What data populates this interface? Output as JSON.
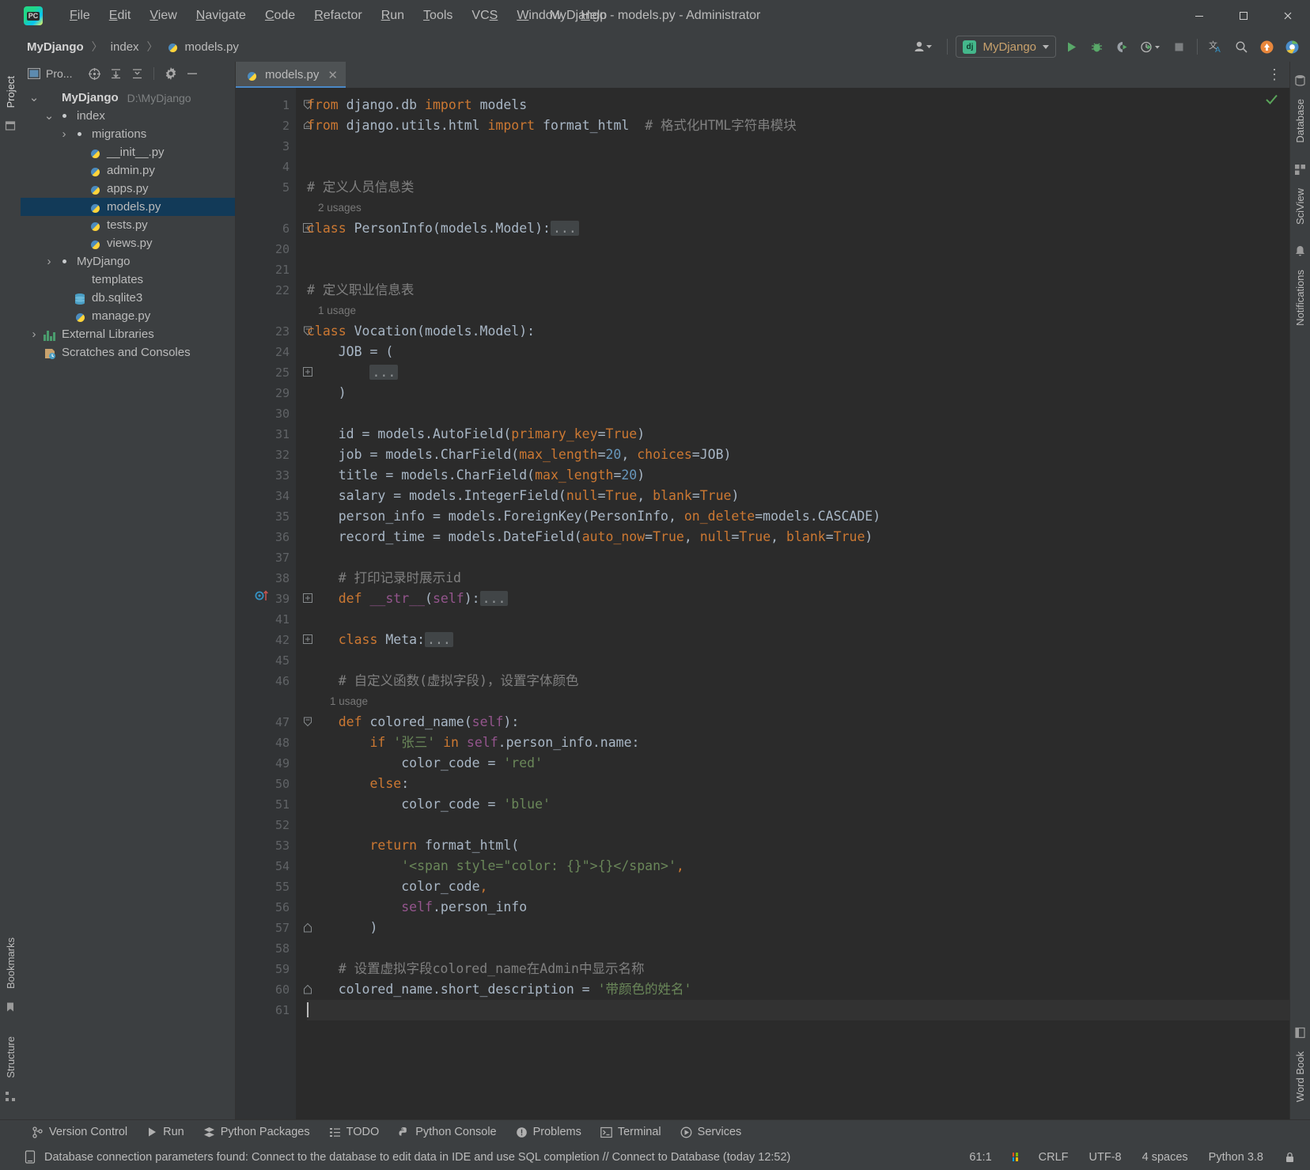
{
  "window": {
    "title": "MyDjango - models.py - Administrator",
    "logo_text": "PC",
    "minimize": "—",
    "maximize": "☐",
    "close": "✕"
  },
  "menu": [
    {
      "label": "File"
    },
    {
      "label": "Edit"
    },
    {
      "label": "View"
    },
    {
      "label": "Navigate"
    },
    {
      "label": "Code"
    },
    {
      "label": "Refactor"
    },
    {
      "label": "Run"
    },
    {
      "label": "Tools"
    },
    {
      "label": "VCS"
    },
    {
      "label": "Window"
    },
    {
      "label": "Help"
    }
  ],
  "breadcrumbs": [
    {
      "label": "MyDjango",
      "bold": true
    },
    {
      "label": "index",
      "bold": false
    },
    {
      "label": "models.py",
      "bold": false
    }
  ],
  "toolbar": {
    "run_config": "MyDjango",
    "django_badge": "dj",
    "run_tooltip": "Run",
    "debug_tooltip": "Debug",
    "coverage_tooltip": "Run with Coverage",
    "profile_tooltip": "Profile",
    "stop_tooltip": "Stop",
    "translate_tooltip": "Translate",
    "search_tooltip": "Search Everywhere",
    "updates_tooltip": "Updates",
    "browser_tooltip": "Open in Browser"
  },
  "project_panel": {
    "header_title": "Pro...",
    "tree": [
      {
        "depth": 0,
        "label": "MyDjango",
        "path": "D:\\MyDjango",
        "icon": "folder",
        "arrow": "down",
        "bold": true,
        "selected": false
      },
      {
        "depth": 1,
        "label": "index",
        "path": "",
        "icon": "folder-source",
        "arrow": "down",
        "bold": false,
        "selected": false
      },
      {
        "depth": 2,
        "label": "migrations",
        "path": "",
        "icon": "folder-source",
        "arrow": "right",
        "bold": false,
        "selected": false
      },
      {
        "depth": 3,
        "label": "__init__.py",
        "path": "",
        "icon": "python",
        "arrow": "none",
        "bold": false,
        "selected": false
      },
      {
        "depth": 3,
        "label": "admin.py",
        "path": "",
        "icon": "python",
        "arrow": "none",
        "bold": false,
        "selected": false
      },
      {
        "depth": 3,
        "label": "apps.py",
        "path": "",
        "icon": "python",
        "arrow": "none",
        "bold": false,
        "selected": false
      },
      {
        "depth": 3,
        "label": "models.py",
        "path": "",
        "icon": "python",
        "arrow": "none",
        "bold": false,
        "selected": true
      },
      {
        "depth": 3,
        "label": "tests.py",
        "path": "",
        "icon": "python",
        "arrow": "none",
        "bold": false,
        "selected": false
      },
      {
        "depth": 3,
        "label": "views.py",
        "path": "",
        "icon": "python",
        "arrow": "none",
        "bold": false,
        "selected": false
      },
      {
        "depth": 1,
        "label": "MyDjango",
        "path": "",
        "icon": "folder-source",
        "arrow": "right",
        "bold": false,
        "selected": false
      },
      {
        "depth": 2,
        "label": "templates",
        "path": "",
        "icon": "folder-template",
        "arrow": "none",
        "bold": false,
        "selected": false
      },
      {
        "depth": 2,
        "label": "db.sqlite3",
        "path": "",
        "icon": "database",
        "arrow": "none",
        "bold": false,
        "selected": false
      },
      {
        "depth": 2,
        "label": "manage.py",
        "path": "",
        "icon": "python",
        "arrow": "none",
        "bold": false,
        "selected": false
      },
      {
        "depth": 0,
        "label": "External Libraries",
        "path": "",
        "icon": "library",
        "arrow": "right",
        "bold": false,
        "selected": false
      },
      {
        "depth": 0,
        "label": "Scratches and Consoles",
        "path": "",
        "icon": "scratch",
        "arrow": "none",
        "bold": false,
        "selected": false
      }
    ]
  },
  "left_strip": {
    "project_tab": "Project",
    "bookmarks_tab": "Bookmarks",
    "structure_tab": "Structure"
  },
  "right_strip": {
    "database_tab": "Database",
    "sciview_tab": "SciView",
    "notifications_tab": "Notifications",
    "wordbook_tab": "Word Book"
  },
  "editor": {
    "tab_label": "models.py",
    "tab_close": "✕",
    "more_actions": "⋮",
    "lines": [
      {
        "num": "1",
        "fold": "down-start",
        "indent": 0,
        "tokens": [
          {
            "t": "from",
            "c": "kw"
          },
          {
            "t": " django.db ",
            "c": ""
          },
          {
            "t": "import",
            "c": "kw"
          },
          {
            "t": " models",
            "c": ""
          }
        ]
      },
      {
        "num": "2",
        "fold": "end",
        "indent": 0,
        "tokens": [
          {
            "t": "from",
            "c": "kw"
          },
          {
            "t": " django.utils.html ",
            "c": ""
          },
          {
            "t": "import",
            "c": "kw"
          },
          {
            "t": " format_html  ",
            "c": ""
          },
          {
            "t": "# 格式化HTML字符串模块",
            "c": "com"
          }
        ]
      },
      {
        "num": "3",
        "fold": "",
        "indent": 0,
        "tokens": []
      },
      {
        "num": "4",
        "fold": "",
        "indent": 0,
        "tokens": []
      },
      {
        "num": "5",
        "fold": "",
        "indent": 0,
        "tokens": [
          {
            "t": "# 定义人员信息类",
            "c": "com"
          }
        ]
      },
      {
        "num": "",
        "fold": "",
        "indent": 0,
        "usage": "2 usages"
      },
      {
        "num": "6",
        "fold": "plus",
        "indent": 0,
        "tokens": [
          {
            "t": "class",
            "c": "kw"
          },
          {
            "t": " PersonInfo(models.Model):",
            "c": ""
          },
          {
            "t": "...",
            "c": "dots"
          }
        ]
      },
      {
        "num": "20",
        "fold": "",
        "indent": 0,
        "tokens": []
      },
      {
        "num": "21",
        "fold": "",
        "indent": 0,
        "tokens": []
      },
      {
        "num": "22",
        "fold": "",
        "indent": 0,
        "tokens": [
          {
            "t": "# 定义职业信息表",
            "c": "com"
          }
        ]
      },
      {
        "num": "",
        "fold": "",
        "indent": 0,
        "usage": "1 usage"
      },
      {
        "num": "23",
        "fold": "down-start",
        "indent": 0,
        "tokens": [
          {
            "t": "class",
            "c": "kw"
          },
          {
            "t": " Vocation(models.Model):",
            "c": ""
          }
        ]
      },
      {
        "num": "24",
        "fold": "",
        "indent": 1,
        "tokens": [
          {
            "t": "    JOB = (",
            "c": ""
          }
        ]
      },
      {
        "num": "25",
        "fold": "plus",
        "indent": 2,
        "tokens": [
          {
            "t": "        ",
            "c": ""
          },
          {
            "t": "...",
            "c": "dots"
          }
        ]
      },
      {
        "num": "29",
        "fold": "",
        "indent": 1,
        "tokens": [
          {
            "t": "    )",
            "c": ""
          }
        ]
      },
      {
        "num": "30",
        "fold": "",
        "indent": 0,
        "tokens": []
      },
      {
        "num": "31",
        "fold": "",
        "indent": 1,
        "tokens": [
          {
            "t": "    id = models.AutoField(",
            "c": ""
          },
          {
            "t": "primary_key",
            "c": "param"
          },
          {
            "t": "=",
            "c": ""
          },
          {
            "t": "True",
            "c": "kw"
          },
          {
            "t": ")",
            "c": ""
          }
        ]
      },
      {
        "num": "32",
        "fold": "",
        "indent": 1,
        "tokens": [
          {
            "t": "    job = models.CharField(",
            "c": ""
          },
          {
            "t": "max_length",
            "c": "param"
          },
          {
            "t": "=",
            "c": ""
          },
          {
            "t": "20",
            "c": "num"
          },
          {
            "t": ", ",
            "c": ""
          },
          {
            "t": "choices",
            "c": "param"
          },
          {
            "t": "=JOB)",
            "c": ""
          }
        ]
      },
      {
        "num": "33",
        "fold": "",
        "indent": 1,
        "tokens": [
          {
            "t": "    title = models.CharField(",
            "c": ""
          },
          {
            "t": "max_length",
            "c": "param"
          },
          {
            "t": "=",
            "c": ""
          },
          {
            "t": "20",
            "c": "num"
          },
          {
            "t": ")",
            "c": ""
          }
        ]
      },
      {
        "num": "34",
        "fold": "",
        "indent": 1,
        "tokens": [
          {
            "t": "    salary = models.IntegerField(",
            "c": ""
          },
          {
            "t": "null",
            "c": "param"
          },
          {
            "t": "=",
            "c": ""
          },
          {
            "t": "True",
            "c": "kw"
          },
          {
            "t": ", ",
            "c": ""
          },
          {
            "t": "blank",
            "c": "param"
          },
          {
            "t": "=",
            "c": ""
          },
          {
            "t": "True",
            "c": "kw"
          },
          {
            "t": ")",
            "c": ""
          }
        ]
      },
      {
        "num": "35",
        "fold": "",
        "indent": 1,
        "tokens": [
          {
            "t": "    person_info = models.ForeignKey(PersonInfo, ",
            "c": ""
          },
          {
            "t": "on_delete",
            "c": "param"
          },
          {
            "t": "=models.CASCADE)",
            "c": ""
          }
        ]
      },
      {
        "num": "36",
        "fold": "",
        "indent": 1,
        "tokens": [
          {
            "t": "    record_time = models.DateField(",
            "c": ""
          },
          {
            "t": "auto_now",
            "c": "param"
          },
          {
            "t": "=",
            "c": ""
          },
          {
            "t": "True",
            "c": "kw"
          },
          {
            "t": ", ",
            "c": ""
          },
          {
            "t": "null",
            "c": "param"
          },
          {
            "t": "=",
            "c": ""
          },
          {
            "t": "True",
            "c": "kw"
          },
          {
            "t": ", ",
            "c": ""
          },
          {
            "t": "blank",
            "c": "param"
          },
          {
            "t": "=",
            "c": ""
          },
          {
            "t": "True",
            "c": "kw"
          },
          {
            "t": ")",
            "c": ""
          }
        ]
      },
      {
        "num": "37",
        "fold": "",
        "indent": 0,
        "tokens": []
      },
      {
        "num": "38",
        "fold": "",
        "indent": 1,
        "tokens": [
          {
            "t": "    # 打印记录时展示id",
            "c": "com"
          }
        ]
      },
      {
        "num": "39",
        "fold": "plus",
        "gmark": "override",
        "indent": 1,
        "tokens": [
          {
            "t": "    ",
            "c": ""
          },
          {
            "t": "def",
            "c": "kw"
          },
          {
            "t": " ",
            "c": ""
          },
          {
            "t": "__str__",
            "c": "self"
          },
          {
            "t": "(",
            "c": ""
          },
          {
            "t": "self",
            "c": "self"
          },
          {
            "t": "):",
            "c": ""
          },
          {
            "t": "...",
            "c": "dots"
          }
        ]
      },
      {
        "num": "41",
        "fold": "",
        "indent": 0,
        "tokens": []
      },
      {
        "num": "42",
        "fold": "plus",
        "indent": 1,
        "tokens": [
          {
            "t": "    ",
            "c": ""
          },
          {
            "t": "class",
            "c": "kw"
          },
          {
            "t": " Meta:",
            "c": ""
          },
          {
            "t": "...",
            "c": "dots"
          }
        ]
      },
      {
        "num": "45",
        "fold": "",
        "indent": 0,
        "tokens": []
      },
      {
        "num": "46",
        "fold": "",
        "indent": 1,
        "tokens": [
          {
            "t": "    # 自定义函数(虚拟字段)，设置字体颜色",
            "c": "com"
          }
        ]
      },
      {
        "num": "",
        "fold": "",
        "indent": 1,
        "usage": "    1 usage"
      },
      {
        "num": "47",
        "fold": "down-start",
        "indent": 1,
        "tokens": [
          {
            "t": "    ",
            "c": ""
          },
          {
            "t": "def",
            "c": "kw"
          },
          {
            "t": " ",
            "c": ""
          },
          {
            "t": "colored_name",
            "c": ""
          },
          {
            "t": "(",
            "c": ""
          },
          {
            "t": "self",
            "c": "self"
          },
          {
            "t": "):",
            "c": ""
          }
        ]
      },
      {
        "num": "48",
        "fold": "",
        "indent": 2,
        "tokens": [
          {
            "t": "        ",
            "c": ""
          },
          {
            "t": "if",
            "c": "kw"
          },
          {
            "t": " ",
            "c": ""
          },
          {
            "t": "'张三'",
            "c": "str"
          },
          {
            "t": " ",
            "c": ""
          },
          {
            "t": "in",
            "c": "kw"
          },
          {
            "t": " ",
            "c": ""
          },
          {
            "t": "self",
            "c": "self"
          },
          {
            "t": ".person_info.name:",
            "c": ""
          }
        ]
      },
      {
        "num": "49",
        "fold": "",
        "indent": 3,
        "tokens": [
          {
            "t": "            color_code = ",
            "c": ""
          },
          {
            "t": "'red'",
            "c": "str"
          }
        ]
      },
      {
        "num": "50",
        "fold": "",
        "indent": 2,
        "tokens": [
          {
            "t": "        ",
            "c": ""
          },
          {
            "t": "else",
            "c": "kw"
          },
          {
            "t": ":",
            "c": ""
          }
        ]
      },
      {
        "num": "51",
        "fold": "",
        "indent": 3,
        "tokens": [
          {
            "t": "            color_code = ",
            "c": ""
          },
          {
            "t": "'blue'",
            "c": "str"
          }
        ]
      },
      {
        "num": "52",
        "fold": "",
        "indent": 2,
        "tokens": []
      },
      {
        "num": "53",
        "fold": "",
        "indent": 2,
        "tokens": [
          {
            "t": "        ",
            "c": ""
          },
          {
            "t": "return",
            "c": "kw"
          },
          {
            "t": " format_html(",
            "c": ""
          }
        ]
      },
      {
        "num": "54",
        "fold": "",
        "indent": 3,
        "tokens": [
          {
            "t": "            ",
            "c": ""
          },
          {
            "t": "'<span style=\"color: {}\">{}</span>'",
            "c": "str"
          },
          {
            "t": ",",
            "c": "kw"
          }
        ]
      },
      {
        "num": "55",
        "fold": "",
        "indent": 3,
        "tokens": [
          {
            "t": "            color_code",
            "c": ""
          },
          {
            "t": ",",
            "c": "kw"
          }
        ]
      },
      {
        "num": "56",
        "fold": "",
        "indent": 3,
        "tokens": [
          {
            "t": "            ",
            "c": ""
          },
          {
            "t": "self",
            "c": "self"
          },
          {
            "t": ".person_info",
            "c": ""
          }
        ]
      },
      {
        "num": "57",
        "fold": "up-end",
        "indent": 2,
        "tokens": [
          {
            "t": "        )",
            "c": ""
          }
        ]
      },
      {
        "num": "58",
        "fold": "",
        "indent": 0,
        "tokens": []
      },
      {
        "num": "59",
        "fold": "",
        "indent": 1,
        "tokens": [
          {
            "t": "    # 设置虚拟字段colored_name在Admin中显示名称",
            "c": "com"
          }
        ]
      },
      {
        "num": "60",
        "fold": "up-end",
        "indent": 1,
        "tokens": [
          {
            "t": "    colored_name.short_description = ",
            "c": ""
          },
          {
            "t": "'带颜色的姓名'",
            "c": "str"
          }
        ]
      },
      {
        "num": "61",
        "fold": "",
        "indent": 1,
        "current": true,
        "caret": true,
        "tokens": []
      }
    ]
  },
  "bottom_bar": [
    {
      "label": "Version Control",
      "icon": "branch-icon"
    },
    {
      "label": "Run",
      "icon": "play-icon"
    },
    {
      "label": "Python Packages",
      "icon": "packages-icon"
    },
    {
      "label": "TODO",
      "icon": "todo-icon"
    },
    {
      "label": "Python Console",
      "icon": "python-icon"
    },
    {
      "label": "Problems",
      "icon": "problems-icon"
    },
    {
      "label": "Terminal",
      "icon": "terminal-icon"
    },
    {
      "label": "Services",
      "icon": "services-icon"
    }
  ],
  "status_bar": {
    "message": "Database connection parameters found: Connect to the database to edit data in IDE and use SQL completion // Connect to Database (today 12:52)",
    "caret_position": "61:1",
    "line_separator": "CRLF",
    "encoding": "UTF-8",
    "indent": "4 spaces",
    "interpreter": "Python 3.8"
  },
  "colors": {
    "chrome": "#3c3f41",
    "editor_bg": "#2b2b2b",
    "gutter_bg": "#313335",
    "selection": "#123a58",
    "accent": "#4a88c7",
    "keyword": "#cc7832",
    "string": "#6a8759",
    "number": "#6897bb",
    "comment": "#808080",
    "self": "#94558d",
    "run_green": "#59a869"
  }
}
